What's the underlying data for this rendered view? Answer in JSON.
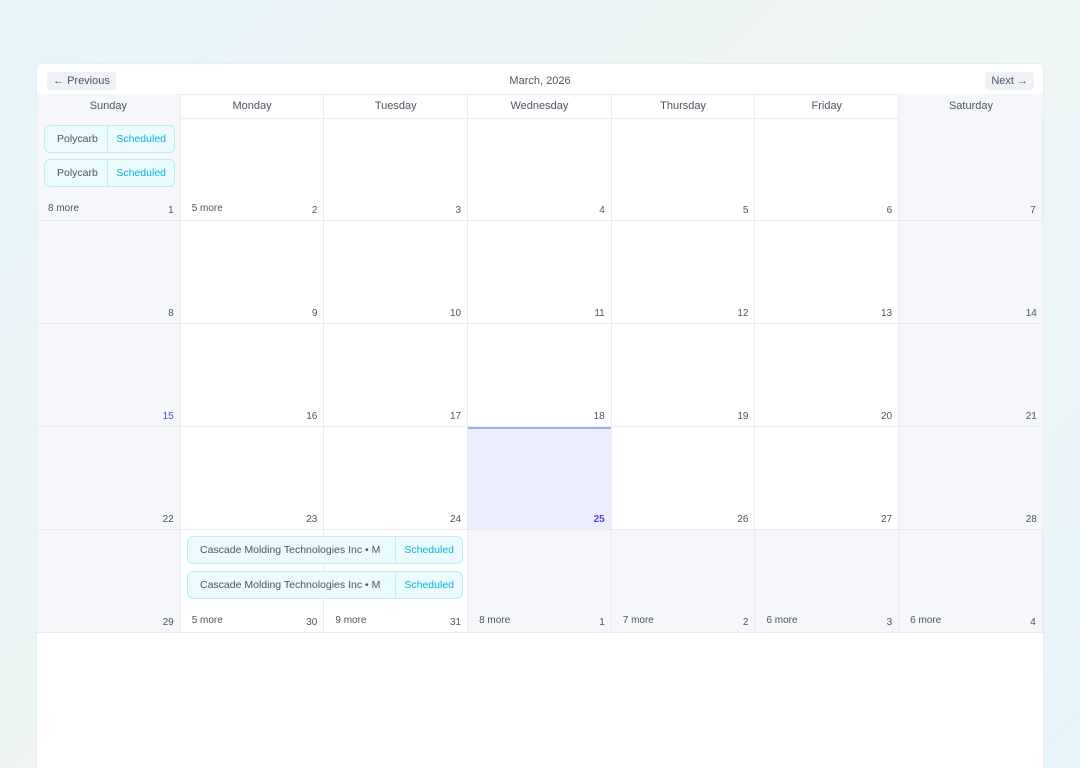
{
  "header": {
    "prev_label": "Previous",
    "next_label": "Next",
    "title": "March, 2026",
    "prev_icon": "arrow-left-icon",
    "next_icon": "arrow-right-icon"
  },
  "weekdays": [
    "Sunday",
    "Monday",
    "Tuesday",
    "Wednesday",
    "Thursday",
    "Friday",
    "Saturday"
  ],
  "weeks": [
    {
      "days": [
        {
          "num": "1",
          "more": "8 more"
        },
        {
          "num": "2",
          "more": "5 more"
        },
        {
          "num": "3"
        },
        {
          "num": "4"
        },
        {
          "num": "5"
        },
        {
          "num": "6"
        },
        {
          "num": "7"
        }
      ],
      "events": [
        {
          "name": "Polycarb",
          "status": "Scheduled"
        },
        {
          "name": "Polycarb",
          "status": "Scheduled"
        }
      ]
    },
    {
      "days": [
        {
          "num": "8"
        },
        {
          "num": "9"
        },
        {
          "num": "10"
        },
        {
          "num": "11"
        },
        {
          "num": "12"
        },
        {
          "num": "13"
        },
        {
          "num": "14"
        }
      ]
    },
    {
      "days": [
        {
          "num": "15"
        },
        {
          "num": "16"
        },
        {
          "num": "17"
        },
        {
          "num": "18"
        },
        {
          "num": "19"
        },
        {
          "num": "20"
        },
        {
          "num": "21"
        }
      ]
    },
    {
      "days": [
        {
          "num": "22"
        },
        {
          "num": "23"
        },
        {
          "num": "24"
        },
        {
          "num": "25"
        },
        {
          "num": "26"
        },
        {
          "num": "27"
        },
        {
          "num": "28"
        }
      ]
    },
    {
      "days": [
        {
          "num": "29"
        },
        {
          "num": "30",
          "more": "5 more"
        },
        {
          "num": "31",
          "more": "9 more"
        },
        {
          "num": "1",
          "more": "8 more"
        },
        {
          "num": "2",
          "more": "7 more"
        },
        {
          "num": "3",
          "more": "6 more"
        },
        {
          "num": "4",
          "more": "6 more"
        }
      ],
      "events": [
        {
          "name": "Cascade Molding Technologies Inc • M",
          "status": "Scheduled"
        },
        {
          "name": "Cascade Molding Technologies Inc • M",
          "status": "Scheduled"
        }
      ]
    }
  ],
  "colors": {
    "accent": "#4f46e5",
    "today_bg": "#ebeefc",
    "event_bg": "#ebfbfd",
    "event_status": "#06b6d4"
  }
}
